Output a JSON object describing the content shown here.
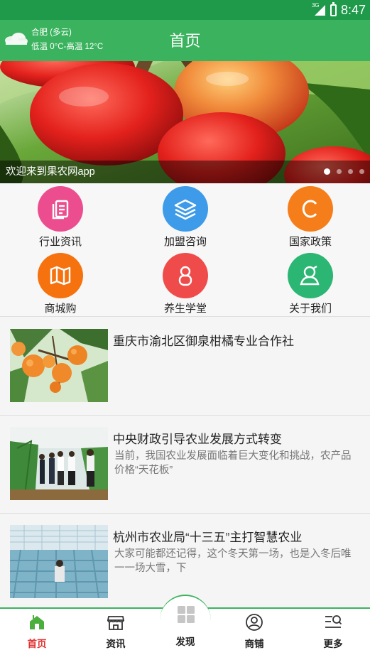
{
  "status_bar": {
    "network": "3G",
    "time": "8:47"
  },
  "header": {
    "weather_icon": "cloudy-icon",
    "city_weather": "合肥 (多云)",
    "temperature": "低温 0°C-高温 12°C",
    "title": "首页"
  },
  "banner": {
    "caption": "欢迎来到果农网app",
    "page_count": 4,
    "active_page": 1
  },
  "grid_menu": [
    {
      "label": "行业资讯",
      "icon": "document-icon",
      "color": "#ec4d8e"
    },
    {
      "label": "加盟咨询",
      "icon": "layers-icon",
      "color": "#3d9be9"
    },
    {
      "label": "国家政策",
      "icon": "letter-c-icon",
      "color": "#f57e1a"
    },
    {
      "label": "商城购",
      "icon": "map-icon",
      "color": "#f5720f"
    },
    {
      "label": "养生学堂",
      "icon": "figure-icon",
      "color": "#f04b4b"
    },
    {
      "label": "关于我们",
      "icon": "user-icon",
      "color": "#2bb673"
    }
  ],
  "news": [
    {
      "title": "重庆市渝北区御泉柑橘专业合作社",
      "desc": ""
    },
    {
      "title": "中央财政引导农业发展方式转变",
      "desc": "当前，我国农业发展面临着巨大变化和挑战，农产品价格“天花板”"
    },
    {
      "title": "杭州市农业局“十三五”主打智慧农业",
      "desc": "大家可能都还记得，这个冬天第一场，也是入冬后唯一一场大雪，下"
    }
  ],
  "bottom_nav": {
    "items": [
      {
        "label": "首页",
        "icon": "home-icon",
        "active": true
      },
      {
        "label": "资讯",
        "icon": "store-icon",
        "active": false
      },
      {
        "label": "发现",
        "icon": "grid-icon",
        "active": false
      },
      {
        "label": "商铺",
        "icon": "person-circle-icon",
        "active": false
      },
      {
        "label": "更多",
        "icon": "menu-search-icon",
        "active": false
      }
    ]
  },
  "colors": {
    "status_bar": "#1e9a4a",
    "header": "#3bb35e",
    "active_nav": "#e0302f"
  }
}
